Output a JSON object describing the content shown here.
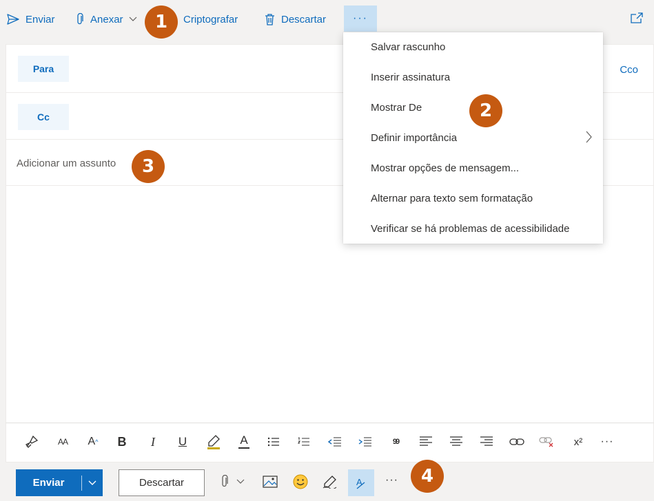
{
  "toolbar": {
    "send_label": "Enviar",
    "attach_label": "Anexar",
    "encrypt_label": "Criptografar",
    "discard_label": "Descartar",
    "more_label": "···"
  },
  "recipients": {
    "to_label": "Para",
    "cc_label": "Cc",
    "bcc_label": "Cco"
  },
  "subject": {
    "placeholder": "Adicionar um assunto"
  },
  "more_menu": {
    "items": [
      {
        "label": "Salvar rascunho"
      },
      {
        "label": "Inserir assinatura"
      },
      {
        "label": "Mostrar De"
      },
      {
        "label": "Definir importância",
        "has_submenu": true
      },
      {
        "label": "Mostrar opções de mensagem..."
      },
      {
        "label": "Alternar para texto sem formatação"
      },
      {
        "label": "Verificar se há problemas de acessibilidade"
      }
    ]
  },
  "format_bar": {
    "icons": [
      "format-painter-icon",
      "font-size-icon",
      "grow-font-icon",
      "bold-icon",
      "italic-icon",
      "underline-icon",
      "highlight-icon",
      "font-color-icon",
      "bullets-icon",
      "numbering-icon",
      "decrease-indent-icon",
      "increase-indent-icon",
      "quote-icon",
      "align-left-icon",
      "align-center-icon",
      "align-right-icon",
      "link-icon",
      "remove-link-icon",
      "superscript-icon",
      "more-formatting-icon"
    ],
    "bold_glyph": "B",
    "italic_glyph": "I",
    "underline_glyph": "U",
    "font_color_glyph": "A",
    "quote_glyph": "99",
    "superscript_glyph": "x²",
    "more_glyph": "···",
    "font_size_glyph": "AA",
    "grow_font_glyph": "A"
  },
  "action_bar": {
    "send_label": "Enviar",
    "discard_label": "Descartar",
    "more_label": "···"
  },
  "callouts": [
    "1",
    "2",
    "3",
    "4"
  ],
  "colors": {
    "accent": "#0f6cbd",
    "callout": "#c55a11",
    "active_bg": "#c7e0f4",
    "chrome_bg": "#f3f2f1"
  }
}
